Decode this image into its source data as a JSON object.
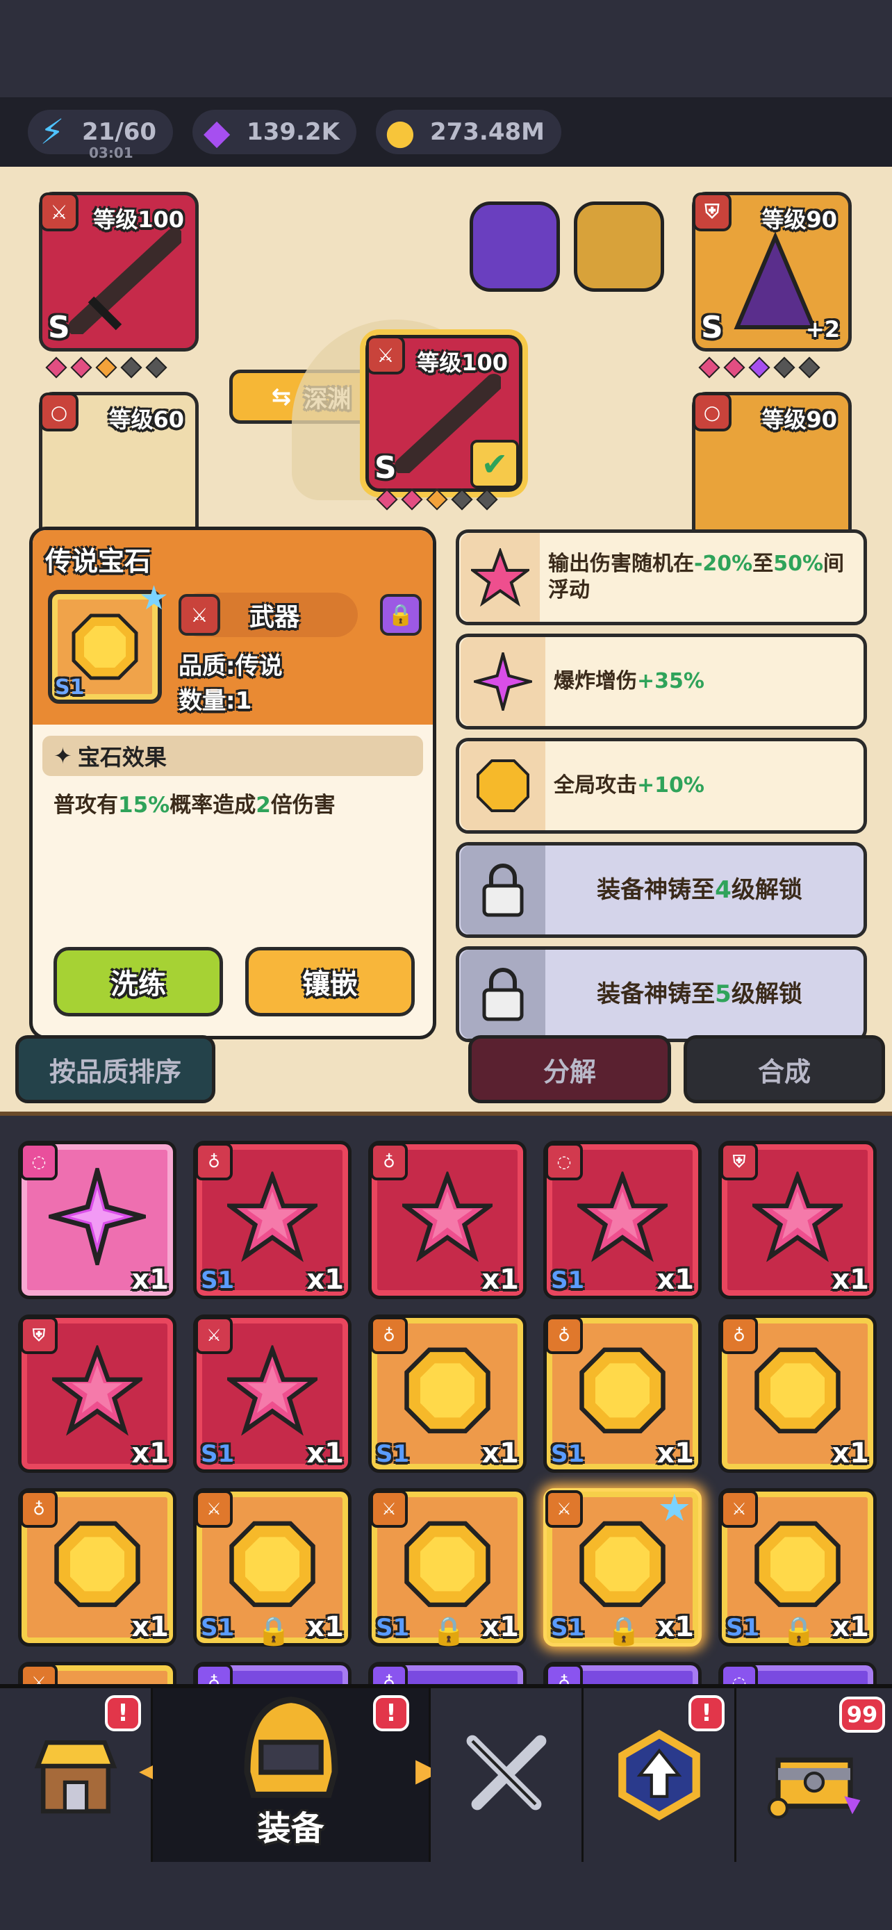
{
  "resources": {
    "energy": {
      "value": "21/60",
      "timer": "03:01"
    },
    "gems": {
      "value": "139.2K"
    },
    "gold": {
      "value": "273.48M"
    }
  },
  "scene": {
    "abyss_button": "深渊",
    "slots": {
      "weapon_left": {
        "level": "等级100",
        "tier": "S"
      },
      "armor_right": {
        "level": "等级90",
        "tier": "S",
        "plus": "+2"
      },
      "left_lower": {
        "level": "等级60"
      },
      "right_lower": {
        "level": "等级90"
      },
      "center": {
        "level": "等级100",
        "tier": "S"
      }
    }
  },
  "panel": {
    "title": "传说宝石",
    "tier_label": "S1",
    "type": "武器",
    "quality": "品质:传说",
    "quantity": "数量:1",
    "effect_header": "宝石效果",
    "effect_pre": "普攻有",
    "effect_pct": "15%",
    "effect_mid": "概率造成",
    "effect_mult": "2",
    "effect_post": "倍伤害",
    "refine_button": "洗练",
    "inlay_button": "镶嵌"
  },
  "effects": [
    {
      "pre": "输出伤害随机在",
      "v1": "-20%",
      "mid": "至",
      "v2": "50%",
      "post": "间浮动",
      "icon": "pink-star-gem-icon"
    },
    {
      "pre": "爆炸增伤",
      "v1": "+35%",
      "icon": "magenta-star-gem-icon"
    },
    {
      "pre": "全局攻击",
      "v1": "+10%",
      "icon": "gold-octagon-gem-icon"
    },
    {
      "pre": "装备神铸至",
      "v1": "4",
      "post": "级解锁",
      "locked": true
    },
    {
      "pre": "装备神铸至",
      "v1": "5",
      "post": "级解锁",
      "locked": true
    }
  ],
  "buttons": {
    "sort": "按品质排序",
    "dismantle": "分解",
    "combine": "合成"
  },
  "inventory": {
    "count_label": "x1",
    "tier_label": "S1"
  },
  "nav": {
    "active_label": "装备",
    "chest_badge": "99",
    "alert": "!"
  },
  "colors": {
    "green_value": "#2fa35a",
    "gold_card": "#ee9a4a",
    "red_card": "#c62a4a"
  }
}
